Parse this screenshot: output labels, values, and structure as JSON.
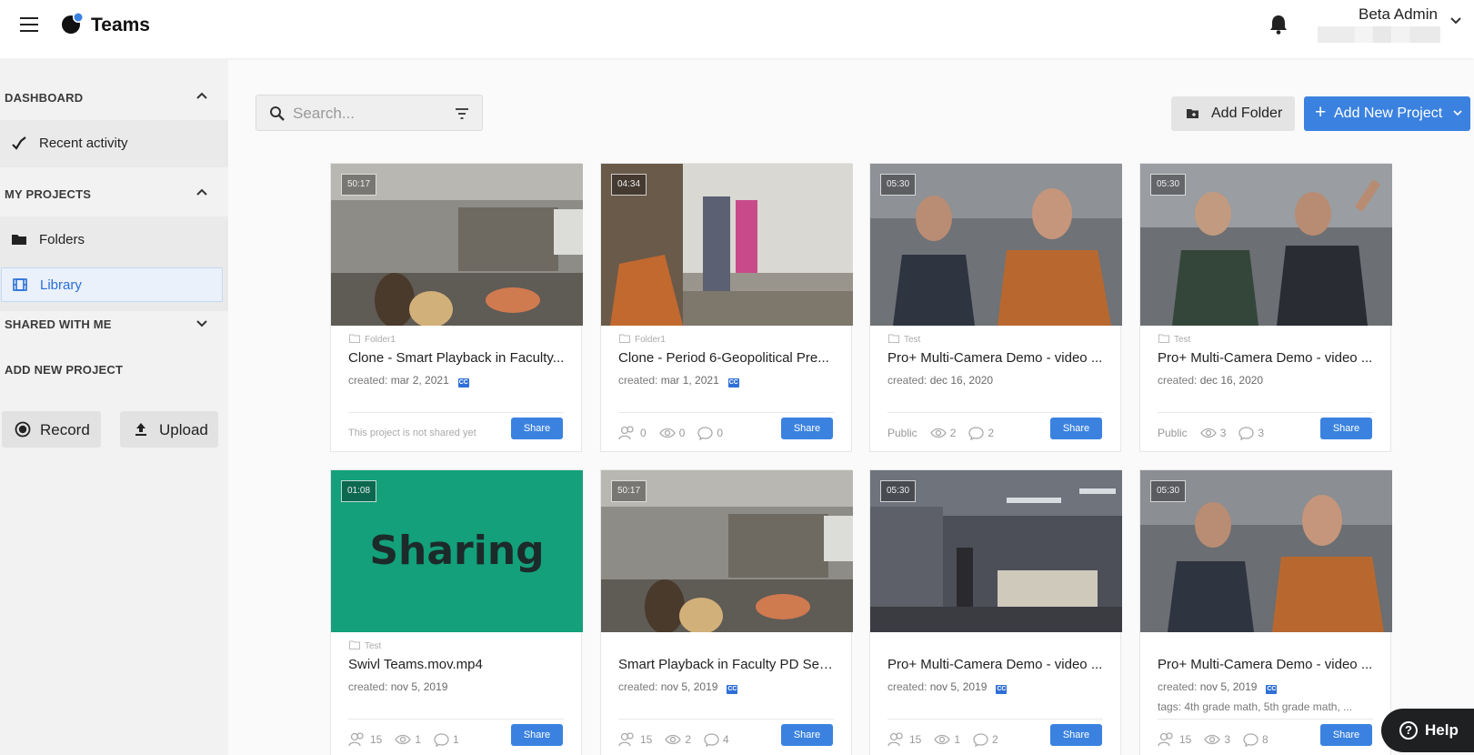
{
  "app": {
    "brand": "Teams"
  },
  "user": {
    "name": "Beta Admin"
  },
  "sidebar": {
    "dashboard": {
      "label": "DASHBOARD",
      "items": [
        {
          "label": "Recent activity"
        }
      ]
    },
    "my_projects": {
      "label": "MY PROJECTS",
      "items": [
        {
          "label": "Folders"
        },
        {
          "label": "Library"
        }
      ]
    },
    "shared": {
      "label": "SHARED WITH ME"
    },
    "add_new": {
      "label": "ADD NEW PROJECT",
      "record": "Record",
      "upload": "Upload"
    }
  },
  "toolbar": {
    "search_placeholder": "Search...",
    "add_folder": "Add Folder",
    "add_new_project": "Add New Project"
  },
  "labels": {
    "created": "created:",
    "share": "Share"
  },
  "projects": [
    {
      "duration": "50:17",
      "folder": "Folder1",
      "title": "Clone - Smart Playback in Faculty...",
      "date": "mar 2, 2021",
      "cc": true,
      "shared_note": "This project is not shared yet"
    },
    {
      "duration": "04:34",
      "folder": "Folder1",
      "title": "Clone - Period 6-Geopolitical Pre...",
      "date": "mar 1, 2021",
      "cc": true,
      "members": "0",
      "views": "0",
      "comments": "0"
    },
    {
      "duration": "05:30",
      "folder": "Test",
      "title": "Pro+ Multi-Camera Demo - video ...",
      "date": "dec 16, 2020",
      "cc": false,
      "visibility": "Public",
      "views": "2",
      "comments": "2"
    },
    {
      "duration": "05:30",
      "folder": "Test",
      "title": "Pro+ Multi-Camera Demo - video ...",
      "date": "dec 16, 2020",
      "cc": false,
      "visibility": "Public",
      "views": "3",
      "comments": "3"
    },
    {
      "duration": "01:08",
      "folder": "Test",
      "title": "Swivl Teams.mov.mp4",
      "date": "nov 5, 2019",
      "cc": false,
      "thumb_text": "Sharing",
      "members": "15",
      "views": "1",
      "comments": "1"
    },
    {
      "duration": "50:17",
      "title": "Smart Playback in Faculty PD Ses...",
      "date": "nov 5, 2019",
      "cc": true,
      "members": "15",
      "views": "2",
      "comments": "4"
    },
    {
      "duration": "05:30",
      "title": "Pro+ Multi-Camera Demo - video ...",
      "date": "nov 5, 2019",
      "cc": true,
      "members": "15",
      "views": "1",
      "comments": "2"
    },
    {
      "duration": "05:30",
      "title": "Pro+ Multi-Camera Demo - video ...",
      "date": "nov 5, 2019",
      "cc": true,
      "tags": "tags: 4th grade math, 5th grade math, ...",
      "members": "15",
      "views": "3",
      "comments": "8"
    }
  ],
  "help": {
    "label": "Help"
  },
  "colors": {
    "accent": "#3b82e0",
    "sharing_bg": "#13a07a"
  }
}
